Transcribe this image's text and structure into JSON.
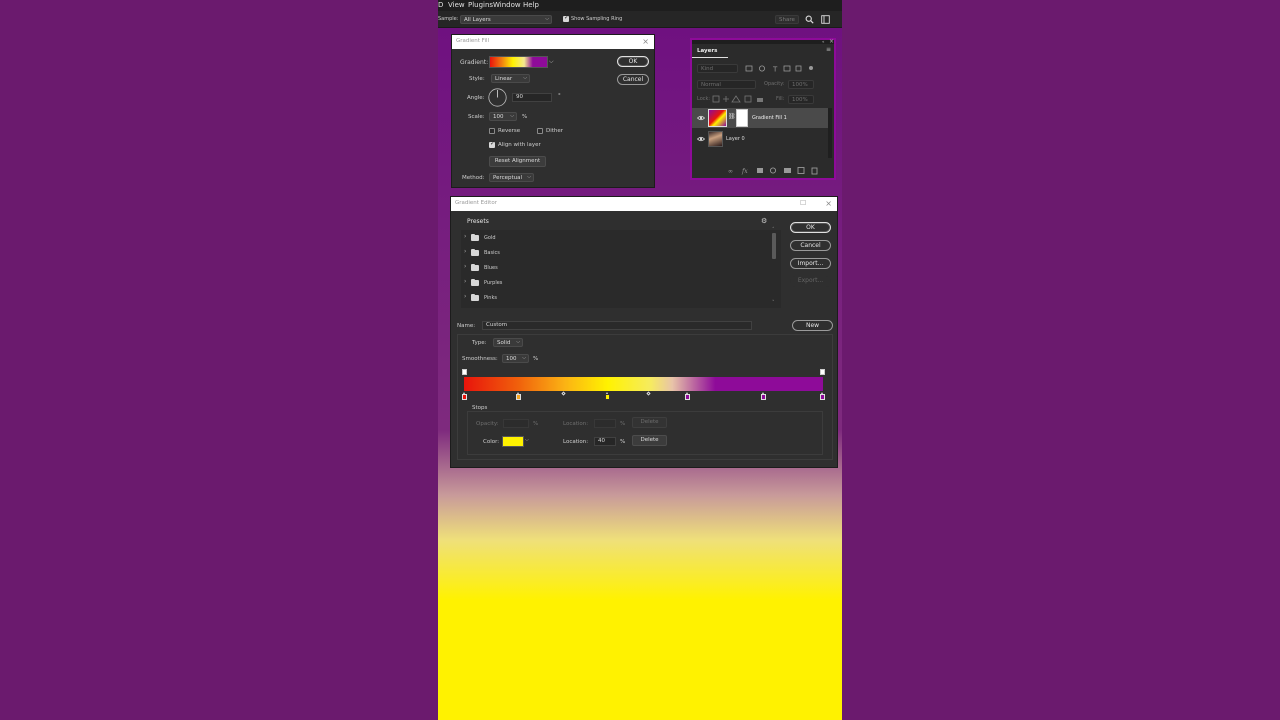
{
  "menubar": {
    "items": [
      "D",
      "View",
      "Plugins",
      "Window",
      "Help"
    ]
  },
  "options_bar": {
    "sample_label": "Sample:",
    "sample_value": "All Layers",
    "show_sampling_ring": "Show Sampling Ring",
    "share_label": "Share"
  },
  "gradient_fill": {
    "title": "Gradient Fill",
    "gradient_label": "Gradient:",
    "style_label": "Style:",
    "style_value": "Linear",
    "angle_label": "Angle:",
    "angle_value": "90",
    "angle_unit": "°",
    "scale_label": "Scale:",
    "scale_value": "100",
    "scale_unit": "%",
    "reverse_label": "Reverse",
    "dither_label": "Dither",
    "align_label": "Align with layer",
    "reset_label": "Reset Alignment",
    "method_label": "Method:",
    "method_value": "Perceptual",
    "ok_label": "OK",
    "cancel_label": "Cancel"
  },
  "layers_panel": {
    "title": "Layers",
    "kind_placeholder": "Kind",
    "blend_mode": "Normal",
    "opacity_label": "Opacity:",
    "opacity_value": "100%",
    "lock_label": "Lock:",
    "fill_label": "Fill:",
    "fill_value": "100%",
    "layers": [
      {
        "name": "Gradient Fill 1"
      },
      {
        "name": "Layer 0"
      }
    ]
  },
  "gradient_editor": {
    "title": "Gradient Editor",
    "presets_label": "Presets",
    "preset_folders": [
      "Gold",
      "Basics",
      "Blues",
      "Purples",
      "Pinks"
    ],
    "ok_label": "OK",
    "cancel_label": "Cancel",
    "import_label": "Import...",
    "export_label": "Export...",
    "name_label": "Name:",
    "name_value": "Custom",
    "new_label": "New",
    "type_label": "Type:",
    "type_value": "Solid",
    "smoothness_label": "Smoothness:",
    "smoothness_value": "100",
    "smoothness_unit": "%",
    "stops_label": "Stops",
    "opacity_label": "Opacity:",
    "opacity_unit": "%",
    "location_label": "Location:",
    "location_unit": "%",
    "delete_label": "Delete",
    "color_label": "Color:",
    "color_location_value": "40",
    "selected_stop_color": "#fff200"
  },
  "colors": {
    "purple": "#8e0b99",
    "yellow": "#fff200",
    "red": "#e8140c"
  }
}
